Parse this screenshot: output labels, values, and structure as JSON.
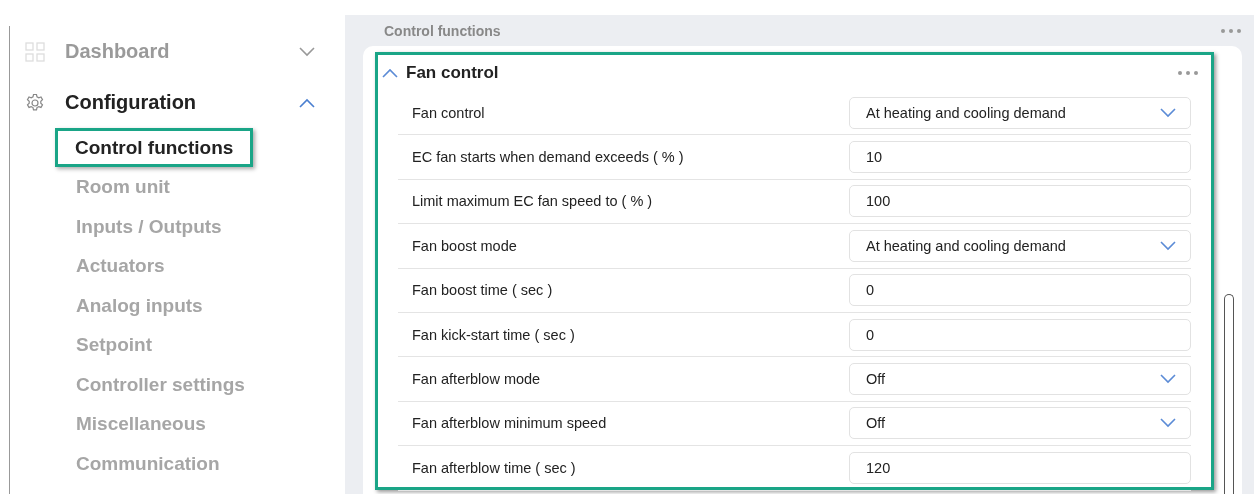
{
  "sidebar": {
    "sections": [
      {
        "label": "Dashboard",
        "kind": "dashboard",
        "expanded": false
      },
      {
        "label": "Configuration",
        "kind": "configuration",
        "expanded": true,
        "children": [
          {
            "label": "Control functions",
            "selected": true
          },
          {
            "label": "Room unit",
            "selected": false
          },
          {
            "label": "Inputs / Outputs",
            "selected": false
          },
          {
            "label": "Actuators",
            "selected": false
          },
          {
            "label": "Analog inputs",
            "selected": false
          },
          {
            "label": "Setpoint",
            "selected": false
          },
          {
            "label": "Controller settings",
            "selected": false
          },
          {
            "label": "Miscellaneous",
            "selected": false
          },
          {
            "label": "Communication",
            "selected": false
          }
        ]
      }
    ]
  },
  "main": {
    "header": "Control functions",
    "panel": {
      "title": "Fan control",
      "expanded": true,
      "highlighted": true,
      "rows": [
        {
          "label": "Fan control",
          "kind": "select",
          "value": "At heating and cooling demand"
        },
        {
          "label": "EC fan starts when demand exceeds ( % )",
          "kind": "number",
          "value": "10"
        },
        {
          "label": "Limit maximum EC fan speed to ( % )",
          "kind": "number",
          "value": "100"
        },
        {
          "label": "Fan boost mode",
          "kind": "select",
          "value": "At heating and cooling demand"
        },
        {
          "label": "Fan boost time ( sec )",
          "kind": "number",
          "value": "0"
        },
        {
          "label": "Fan kick-start time ( sec )",
          "kind": "number",
          "value": "0"
        },
        {
          "label": "Fan afterblow mode",
          "kind": "select",
          "value": "Off"
        },
        {
          "label": "Fan afterblow minimum speed",
          "kind": "select",
          "value": "Off"
        },
        {
          "label": "Fan afterblow time ( sec )",
          "kind": "number",
          "value": "120"
        }
      ]
    }
  }
}
